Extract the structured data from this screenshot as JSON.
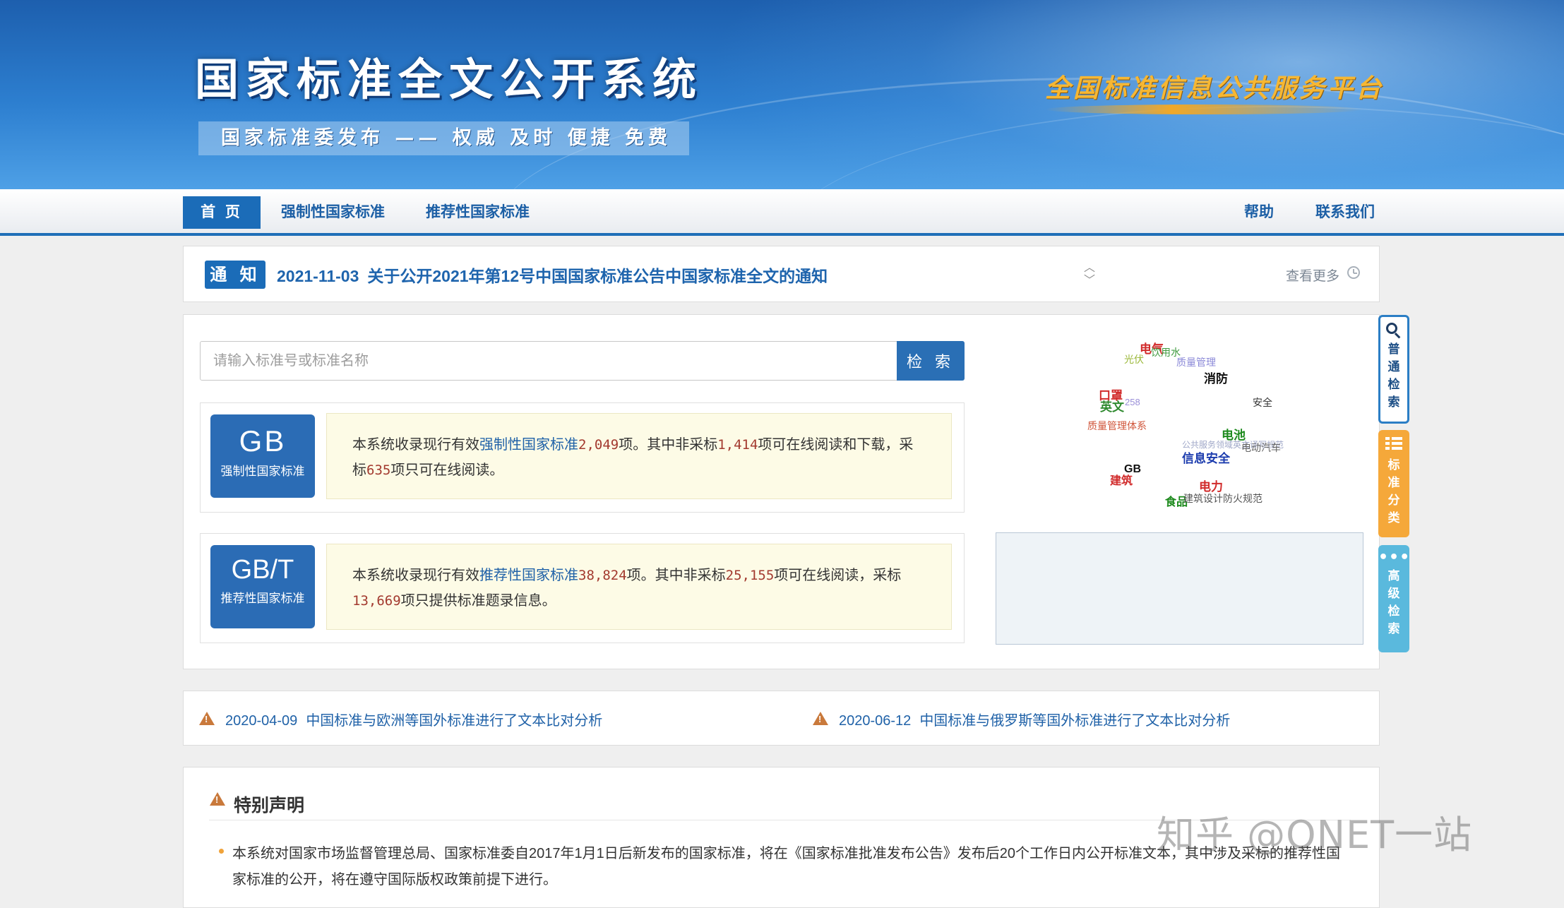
{
  "header": {
    "site_title": "国家标准全文公开系统",
    "slogan": "国家标准委发布 —— 权威 及时 便捷 免费",
    "platform": "全国标准信息公共服务平台"
  },
  "nav": {
    "home": "首 页",
    "mandatory": "强制性国家标准",
    "recommended": "推荐性国家标准",
    "help": "帮助",
    "contact": "联系我们"
  },
  "notice": {
    "badge": "通 知",
    "date": "2021-11-03",
    "title": "关于公开2021年第12号中国国家标准公告中国家标准全文的通知",
    "more": "查看更多"
  },
  "search": {
    "placeholder": "请输入标准号或标准名称",
    "button": "检 索"
  },
  "gb": {
    "code": "GB",
    "caption": "强制性国家标准",
    "t1": "本系统收录现行有效",
    "link": "强制性国家标准",
    "total": "2,049",
    "t2": "项。其中非采标",
    "nonadopt": "1,414",
    "t3": "项可在线阅读和下载，采标",
    "adopt": "635",
    "t4": "项只可在线阅读。"
  },
  "gbt": {
    "code": "GB/T",
    "caption": "推荐性国家标准",
    "t1": "本系统收录现行有效",
    "link": "推荐性国家标准",
    "total": "38,824",
    "t2": "项。其中非采标",
    "nonadopt": "25,155",
    "t3": "项可在线阅读，采标",
    "adopt": "13,669",
    "t4": "项只提供标准题录信息。"
  },
  "tags": {
    "t1": "电气",
    "t2": "饮用水",
    "t3": "光伏",
    "t4": "质量管理",
    "t5": "消防",
    "t6": "口罩",
    "t7": "英文",
    "t8": "258",
    "t9": "安全",
    "t10": "质量管理体系",
    "t11": "电池",
    "t12": "公共服务领域英文译写规范",
    "t13": "电动汽车",
    "t14": "信息安全",
    "t15": "GB",
    "t16": "建筑",
    "t17": "电力",
    "t18": "食品",
    "t19": "建筑设计防火规范"
  },
  "side": {
    "search": "普通检索",
    "classify": "标准分类",
    "advanced": "高级检索"
  },
  "analysis": [
    {
      "date": "2020-04-09",
      "title": "中国标准与欧洲等国外标准进行了文本比对分析"
    },
    {
      "date": "2020-06-12",
      "title": "中国标准与俄罗斯等国外标准进行了文本比对分析"
    }
  ],
  "declaration": {
    "title": "特别声明",
    "text": "本系统对国家市场监督管理总局、国家标准委自2017年1月1日后新发布的国家标准，将在《国家标准批准发布公告》发布后20个工作日内公开标准文本，其中涉及采标的推荐性国家标准的公开，将在遵守国际版权政策前提下进行。"
  },
  "watermark": "知乎 @ONET一站",
  "colors": {
    "brand_blue": "#1b6cb8",
    "link_blue": "#2062a8",
    "number_red": "#a33a2f",
    "accent_orange": "#f5a83a",
    "accent_cyan": "#5ab9dd"
  }
}
